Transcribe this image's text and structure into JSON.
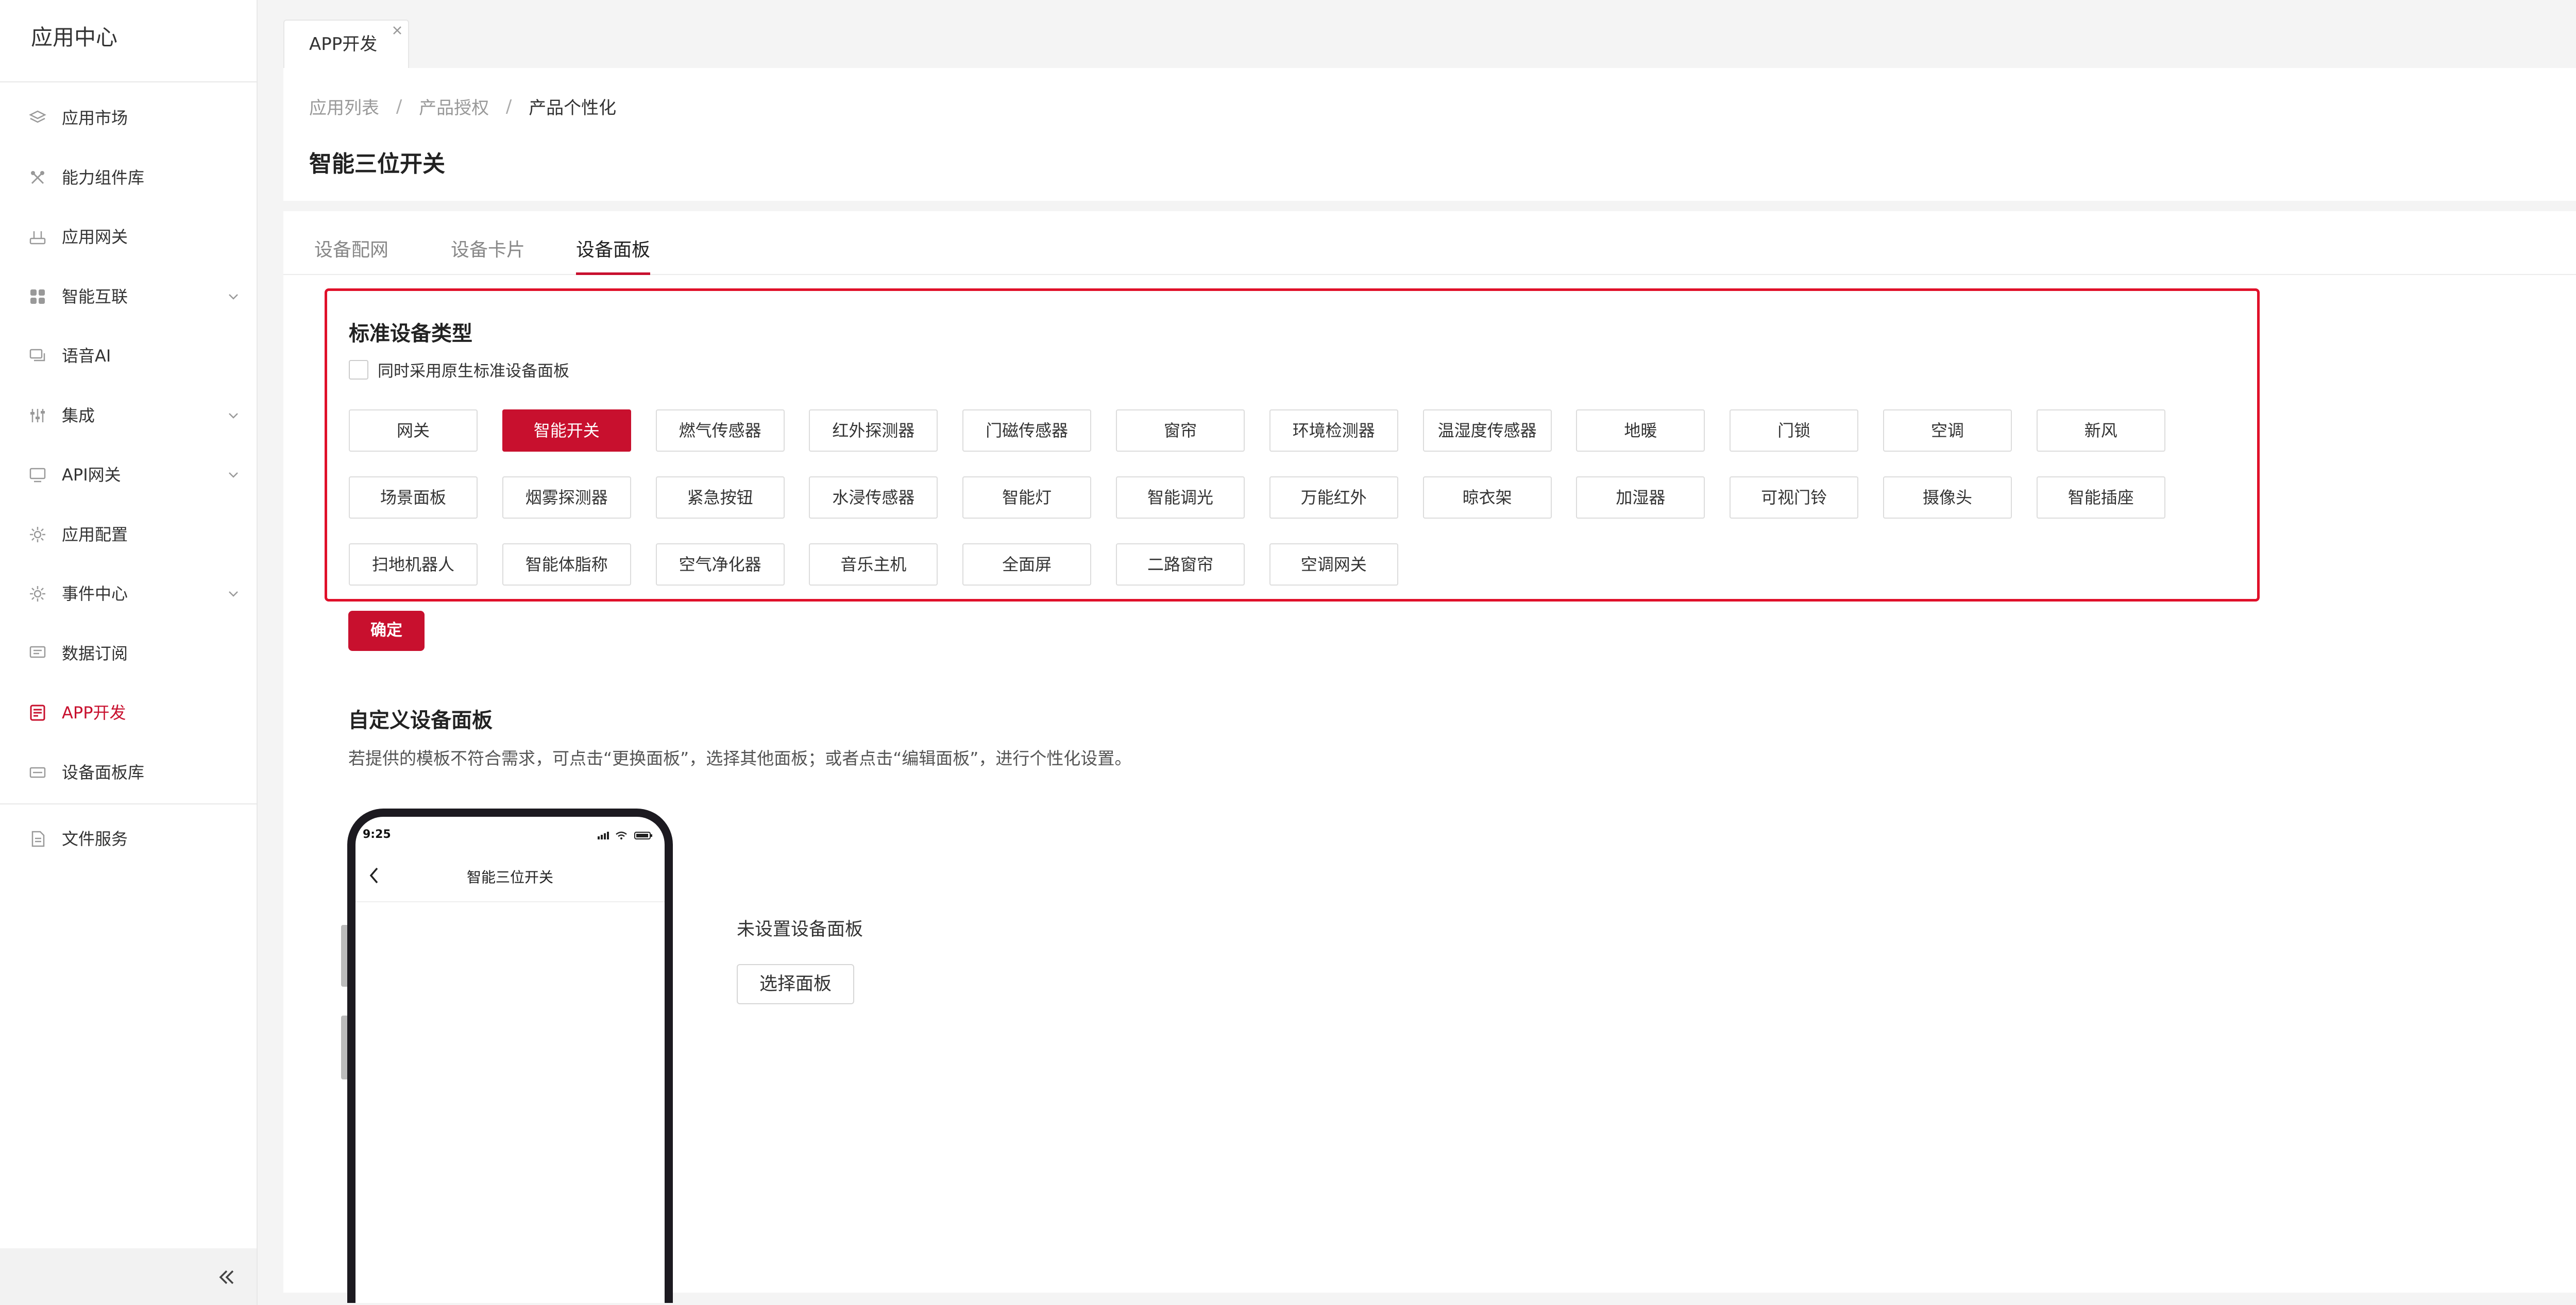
{
  "sidebar": {
    "title": "应用中心",
    "items": [
      {
        "label": "应用市场",
        "icon": "layers-icon",
        "expandable": false
      },
      {
        "label": "能力组件库",
        "icon": "tools-icon",
        "expandable": false
      },
      {
        "label": "应用网关",
        "icon": "router-icon",
        "expandable": false
      },
      {
        "label": "智能互联",
        "icon": "grid-icon",
        "expandable": true
      },
      {
        "label": "语音AI",
        "icon": "chat-icon",
        "expandable": false
      },
      {
        "label": "集成",
        "icon": "sliders-icon",
        "expandable": true
      },
      {
        "label": "API网关",
        "icon": "monitor-icon",
        "expandable": true
      },
      {
        "label": "应用配置",
        "icon": "gear-icon",
        "expandable": false
      },
      {
        "label": "事件中心",
        "icon": "gear-icon",
        "expandable": true
      },
      {
        "label": "数据订阅",
        "icon": "message-icon",
        "expandable": false
      },
      {
        "label": "APP开发",
        "icon": "app-icon",
        "expandable": false,
        "active": true
      },
      {
        "label": "设备面板库",
        "icon": "panel-icon",
        "expandable": false
      },
      {
        "label": "文件服务",
        "icon": "file-icon",
        "expandable": false
      }
    ]
  },
  "page_tab": {
    "label": "APP开发"
  },
  "breadcrumb": [
    "应用列表",
    "产品授权",
    "产品个性化"
  ],
  "page_title": "智能三位开关",
  "tabs": [
    "设备配网",
    "设备卡片",
    "设备面板"
  ],
  "active_tab": 2,
  "standard": {
    "title": "标准设备类型",
    "checkbox_label": "同时采用原生标准设备面板",
    "rows": [
      [
        "网关",
        "智能开关",
        "燃气传感器",
        "红外探测器",
        "门磁传感器",
        "窗帘",
        "环境检测器",
        "温湿度传感器",
        "地暖",
        "门锁",
        "空调",
        "新风"
      ],
      [
        "场景面板",
        "烟雾探测器",
        "紧急按钮",
        "水浸传感器",
        "智能灯",
        "智能调光",
        "万能红外",
        "晾衣架",
        "加湿器",
        "可视门铃",
        "摄像头",
        "智能插座"
      ],
      [
        "扫地机器人",
        "智能体脂称",
        "空气净化器",
        "音乐主机",
        "全面屏",
        "二路窗帘",
        "空调网关"
      ]
    ],
    "selected": "智能开关"
  },
  "confirm_label": "确定",
  "custom": {
    "title": "自定义设备面板",
    "description": "若提供的模板不符合需求，可点击“更换面板”，选择其他面板；或者点击“编辑面板”，进行个性化设置。"
  },
  "phone": {
    "time": "9:25",
    "title": "智能三位开关"
  },
  "empty_text": "未设置设备面板",
  "select_panel_label": "选择面板",
  "colors": {
    "accent": "#c8102e",
    "highlight_border": "#e0102a"
  }
}
